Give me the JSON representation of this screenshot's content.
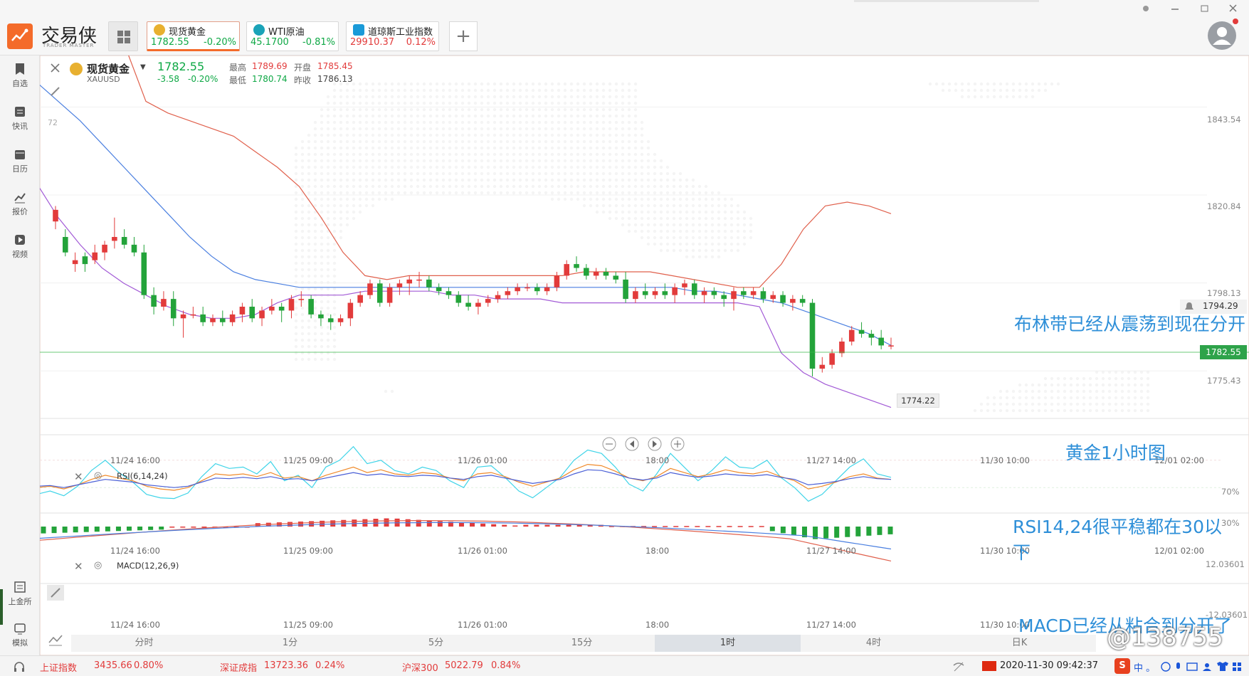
{
  "app": {
    "logo_text": "交易侠",
    "logo_sub": "TRADER MASTER"
  },
  "tickers": [
    {
      "name": "现货黄金",
      "price": "1782.55",
      "change": "-0.20%"
    },
    {
      "name": "WTI原油",
      "price": "45.1700",
      "change": "-0.81%"
    },
    {
      "name": "道琼斯工业指数",
      "price": "29910.37",
      "change": "0.12%"
    }
  ],
  "sidebar": [
    {
      "label": "自选",
      "icon": "bookmark-icon"
    },
    {
      "label": "快讯",
      "icon": "news-icon"
    },
    {
      "label": "日历",
      "icon": "calendar-icon"
    },
    {
      "label": "报价",
      "icon": "quote-icon"
    },
    {
      "label": "视频",
      "icon": "video-icon"
    },
    {
      "label": "上金所",
      "icon": "exchange-icon"
    },
    {
      "label": "模拟",
      "icon": "simulate-icon"
    }
  ],
  "quote": {
    "name": "现货黄金",
    "code": "XAUUSD",
    "price": "1782.55",
    "change": "-3.58",
    "change_pct": "-0.20%",
    "high_label": "最高",
    "high": "1789.69",
    "open_label": "开盘",
    "open": "1785.45",
    "low_label": "最低",
    "low": "1780.74",
    "prev_label": "昨收",
    "prev": "1786.13"
  },
  "chart_data": {
    "type": "candlestick",
    "title": "",
    "price_axis": [
      "1843.54",
      "1820.84",
      "1798.13",
      "1775.43"
    ],
    "current_price": "1782.55",
    "alert_price": "1794.29",
    "low_marker": "1774.22",
    "stub_label": "72",
    "time_axis": [
      "11/24 16:00",
      "11/25 09:00",
      "11/26 01:00",
      "18:00",
      "11/27 14:00",
      "11/30 10:00",
      "12/01 02:00"
    ],
    "ylim": [
      1765,
      1855
    ],
    "candles": [
      [
        1814,
        1818,
        1812,
        1817
      ],
      [
        1810,
        1812,
        1805,
        1806
      ],
      [
        1803,
        1806,
        1801,
        1804
      ],
      [
        1805,
        1806,
        1801,
        1803
      ],
      [
        1804,
        1808,
        1803,
        1806
      ],
      [
        1806,
        1809,
        1804,
        1808
      ],
      [
        1809,
        1815,
        1807,
        1810
      ],
      [
        1810,
        1812,
        1807,
        1808
      ],
      [
        1808,
        1810,
        1805,
        1806
      ],
      [
        1806,
        1808,
        1794,
        1795
      ],
      [
        1795,
        1797,
        1790,
        1792
      ],
      [
        1792,
        1796,
        1791,
        1794
      ],
      [
        1794,
        1796,
        1787,
        1789
      ],
      [
        1789,
        1791,
        1784,
        1790
      ],
      [
        1790,
        1792,
        1789,
        1790
      ],
      [
        1790,
        1792,
        1787,
        1788
      ],
      [
        1788,
        1790,
        1787,
        1789
      ],
      [
        1789,
        1791,
        1787,
        1788
      ],
      [
        1788,
        1791,
        1787,
        1790
      ],
      [
        1790,
        1793,
        1788,
        1792
      ],
      [
        1792,
        1794,
        1788,
        1789
      ],
      [
        1789,
        1792,
        1787,
        1791
      ],
      [
        1791,
        1794,
        1790,
        1792
      ],
      [
        1792,
        1793,
        1788,
        1791
      ],
      [
        1791,
        1795,
        1789,
        1794
      ],
      [
        1794,
        1796,
        1792,
        1794
      ],
      [
        1794,
        1795,
        1789,
        1790
      ],
      [
        1790,
        1791,
        1787,
        1789
      ],
      [
        1789,
        1790,
        1786,
        1788
      ],
      [
        1788,
        1790,
        1787,
        1789
      ],
      [
        1789,
        1794,
        1787,
        1793
      ],
      [
        1793,
        1796,
        1792,
        1795
      ],
      [
        1795,
        1799,
        1794,
        1798
      ],
      [
        1798,
        1799,
        1792,
        1793
      ],
      [
        1793,
        1798,
        1792,
        1797
      ],
      [
        1797,
        1799,
        1795,
        1798
      ],
      [
        1798,
        1800,
        1795,
        1799
      ],
      [
        1799,
        1801,
        1797,
        1799
      ],
      [
        1799,
        1800,
        1796,
        1797
      ],
      [
        1797,
        1798,
        1795,
        1796
      ],
      [
        1796,
        1797,
        1794,
        1795
      ],
      [
        1795,
        1796,
        1792,
        1793
      ],
      [
        1793,
        1795,
        1791,
        1792
      ],
      [
        1792,
        1794,
        1790,
        1793
      ],
      [
        1793,
        1795,
        1792,
        1794
      ],
      [
        1794,
        1796,
        1793,
        1795
      ],
      [
        1795,
        1797,
        1794,
        1796
      ],
      [
        1796,
        1798,
        1795,
        1797
      ],
      [
        1797,
        1798,
        1796,
        1797
      ],
      [
        1797,
        1798,
        1795,
        1796
      ],
      [
        1796,
        1798,
        1795,
        1797
      ],
      [
        1797,
        1801,
        1796,
        1800
      ],
      [
        1800,
        1804,
        1799,
        1803
      ],
      [
        1803,
        1805,
        1801,
        1802
      ],
      [
        1802,
        1803,
        1799,
        1800
      ],
      [
        1800,
        1802,
        1799,
        1801
      ],
      [
        1801,
        1802,
        1799,
        1800
      ],
      [
        1800,
        1801,
        1798,
        1799
      ],
      [
        1799,
        1801,
        1793,
        1794
      ],
      [
        1794,
        1797,
        1793,
        1796
      ],
      [
        1796,
        1798,
        1794,
        1795
      ],
      [
        1795,
        1797,
        1794,
        1796
      ],
      [
        1796,
        1798,
        1794,
        1795
      ],
      [
        1795,
        1798,
        1793,
        1797
      ],
      [
        1797,
        1799,
        1795,
        1798
      ],
      [
        1798,
        1799,
        1794,
        1795
      ],
      [
        1795,
        1797,
        1793,
        1796
      ],
      [
        1796,
        1797,
        1794,
        1795
      ],
      [
        1795,
        1796,
        1792,
        1794
      ],
      [
        1794,
        1797,
        1791,
        1796
      ],
      [
        1796,
        1797,
        1794,
        1795
      ],
      [
        1795,
        1797,
        1794,
        1796
      ],
      [
        1796,
        1797,
        1793,
        1794
      ],
      [
        1794,
        1796,
        1793,
        1795
      ],
      [
        1795,
        1796,
        1792,
        1793
      ],
      [
        1793,
        1795,
        1791,
        1794
      ],
      [
        1794,
        1795,
        1792,
        1793
      ],
      [
        1793,
        1794,
        1774,
        1776
      ],
      [
        1776,
        1779,
        1775,
        1777
      ],
      [
        1777,
        1781,
        1776,
        1780
      ],
      [
        1780,
        1784,
        1779,
        1783
      ],
      [
        1783,
        1787,
        1782,
        1786
      ],
      [
        1786,
        1788,
        1784,
        1785
      ],
      [
        1785,
        1786,
        1782,
        1784
      ],
      [
        1784,
        1786,
        1781,
        1782
      ],
      [
        1782,
        1784,
        1781,
        1782
      ]
    ],
    "boll_upper": [
      1900,
      1895,
      1880,
      1870,
      1860,
      1845,
      1842,
      1840,
      1838,
      1836,
      1832,
      1828,
      1823,
      1815,
      1806,
      1800,
      1799,
      1800,
      1800,
      1800,
      1800,
      1800,
      1800,
      1800,
      1800,
      1801,
      1801,
      1801,
      1801,
      1800,
      1799,
      1798,
      1797,
      1797,
      1803,
      1812,
      1818,
      1819,
      1818,
      1816
    ],
    "boll_mid": [
      1850,
      1845,
      1840,
      1834,
      1828,
      1822,
      1816,
      1810,
      1805,
      1801,
      1799,
      1798,
      1797,
      1797,
      1797,
      1797,
      1797,
      1797,
      1797,
      1797,
      1797,
      1797,
      1797,
      1797,
      1797,
      1797,
      1797,
      1797,
      1797,
      1797,
      1796,
      1796,
      1795,
      1794,
      1793,
      1791,
      1789,
      1787,
      1785,
      1782
    ],
    "boll_lower": [
      1824,
      1815,
      1808,
      1802,
      1798,
      1795,
      1792,
      1790,
      1789,
      1789,
      1790,
      1793,
      1795,
      1795,
      1795,
      1796,
      1796,
      1796,
      1796,
      1795,
      1795,
      1794,
      1794,
      1794,
      1793,
      1793,
      1793,
      1793,
      1793,
      1793,
      1793,
      1793,
      1793,
      1792,
      1780,
      1775,
      1772,
      1770,
      1768,
      1766
    ],
    "rsi": {
      "label": "RSI(6,14,24)",
      "levels": [
        "70%",
        "30%"
      ],
      "time_axis": [
        "11/24 16:00",
        "11/25 09:00",
        "11/26 01:00",
        "18:00",
        "11/27 14:00",
        "11/30 10:00",
        "12/01 02:00"
      ]
    },
    "macd": {
      "label": "MACD(12,26,9)",
      "levels": [
        "12.03601",
        "-12.03601"
      ],
      "time_axis": [
        "11/24 16:00",
        "11/25 09:00",
        "11/26 01:00",
        "18:00",
        "11/27 14:00",
        "11/30 10:00"
      ]
    }
  },
  "timeframes": [
    "分时",
    "1分",
    "5分",
    "15分",
    "1时",
    "4时",
    "日K"
  ],
  "active_timeframe": "1时",
  "annotations": {
    "boll": "布林带已经从震荡到现在分开",
    "title": "黄金1小时图",
    "rsi": "RSI14,24很平稳都在30以下",
    "macd": "MACD已经从粘合到分开了",
    "watermark": "@138755"
  },
  "status_bar": [
    {
      "name": "上证指数",
      "value": "3435.66",
      "change": "0.80%"
    },
    {
      "name": "深证成指",
      "value": "13723.36",
      "change": "0.24%"
    },
    {
      "name": "沪深300",
      "value": "5022.79",
      "change": "0.84%"
    }
  ],
  "datetime": "2020-11-30 09:42:37",
  "ime": "中 。"
}
